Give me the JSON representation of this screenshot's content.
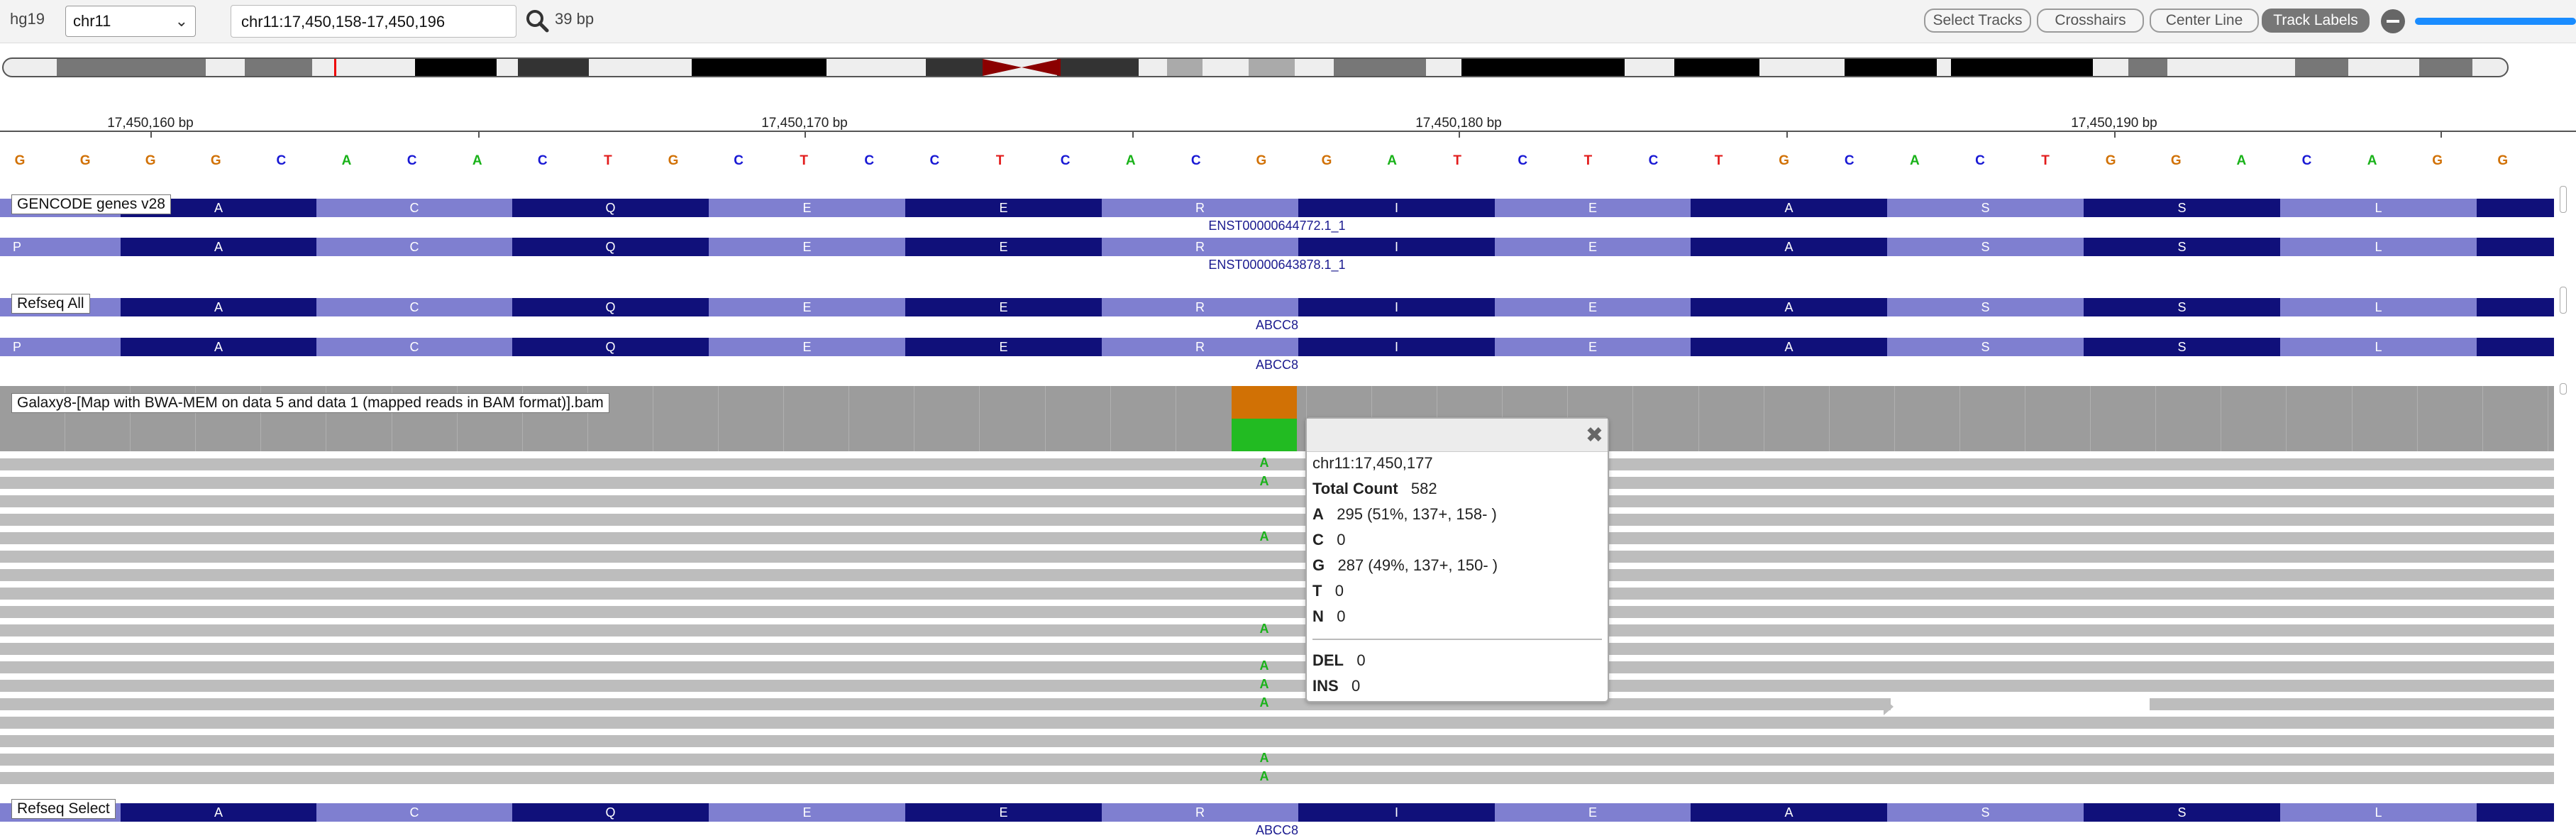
{
  "toolbar": {
    "genome": "hg19",
    "chromosome": "chr11",
    "locus": "chr11:17,450,158-17,450,196",
    "bp_width": "39 bp",
    "buttons": [
      "Select Tracks",
      "Crosshairs",
      "Center Line",
      "Track Labels"
    ]
  },
  "ruler": {
    "ticks": [
      "17,450,160 bp",
      "17,450,170 bp",
      "17,450,180 bp",
      "17,450,190 bp"
    ]
  },
  "sequence": [
    "G",
    "G",
    "G",
    "G",
    "C",
    "A",
    "C",
    "A",
    "C",
    "T",
    "G",
    "C",
    "T",
    "C",
    "C",
    "T",
    "C",
    "A",
    "C",
    "G",
    "G",
    "A",
    "T",
    "C",
    "T",
    "C",
    "T",
    "G",
    "C",
    "A",
    "C",
    "T",
    "G",
    "G",
    "A",
    "C",
    "A",
    "G",
    "G"
  ],
  "sequence_colors": {
    "A": "#19b219",
    "C": "#1818d4",
    "G": "#d17105",
    "T": "#e21b1b"
  },
  "tracks": {
    "gencode_label": "GENCODE genes v28",
    "refseq_all_label": "Refseq All",
    "bam_label": "Galaxy8-[Map with BWA-MEM on data 5 and data 1 (mapped reads in BAM format)].bam",
    "refseq_select_label": "Refseq Select"
  },
  "transcripts": {
    "gencode_1": "ENST00000644772.1_1",
    "gencode_2": "ENST00000643878.1_1",
    "refseq_1": "ABCC8",
    "refseq_2": "ABCC8",
    "refseq_select": "ABCC8"
  },
  "amino_acids": [
    "A",
    "C",
    "Q",
    "E",
    "E",
    "R",
    "I",
    "E",
    "A",
    "S",
    "S",
    "L"
  ],
  "first_codon_p": "P",
  "mismatch_base": "A",
  "popup": {
    "position": "chr11:17,450,177",
    "total_label": "Total Count",
    "total_value": "582",
    "rows": [
      {
        "base": "A",
        "value": "295 (51%, 137+, 158- )"
      },
      {
        "base": "C",
        "value": "0"
      },
      {
        "base": "G",
        "value": "287 (49%, 137+, 150- )"
      },
      {
        "base": "T",
        "value": "0"
      },
      {
        "base": "N",
        "value": "0"
      }
    ],
    "del_label": "DEL",
    "del_value": "0",
    "ins_label": "INS",
    "ins_value": "0"
  },
  "colors": {
    "codon_dark": "#10107a",
    "codon_light": "#7f7fd0",
    "mismatch_A": "#19b219",
    "cov_A": "#22bb22",
    "cov_G": "#d17105",
    "read": "#bdbdbd"
  }
}
